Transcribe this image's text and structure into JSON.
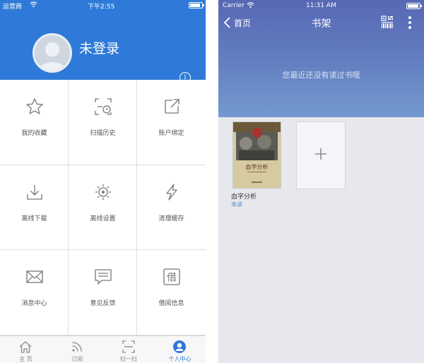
{
  "left": {
    "statusbar": {
      "carrier": "运营商",
      "time": "下午2:55",
      "battery_level": 0.9
    },
    "profile": {
      "username": "未登录",
      "info_icon": "info-icon"
    },
    "grid": [
      {
        "label": "我的收藏",
        "icon": "star-icon"
      },
      {
        "label": "扫描历史",
        "icon": "scan-history-icon"
      },
      {
        "label": "账户绑定",
        "icon": "share-link-icon"
      },
      {
        "label": "离线下载",
        "icon": "download-icon"
      },
      {
        "label": "离线设置",
        "icon": "settings-sun-icon"
      },
      {
        "label": "清理缓存",
        "icon": "lightning-icon"
      },
      {
        "label": "消息中心",
        "icon": "mail-icon"
      },
      {
        "label": "意见反馈",
        "icon": "chat-icon"
      },
      {
        "label": "借阅信息",
        "icon": "borrow-icon",
        "glyph": "借"
      }
    ],
    "tabbar": [
      {
        "label": "主 页",
        "icon": "home-icon",
        "active": false
      },
      {
        "label": "订阅",
        "icon": "rss-icon",
        "active": false
      },
      {
        "label": "扫一扫",
        "icon": "scan-icon",
        "active": false
      },
      {
        "label": "个人中心",
        "icon": "user-icon",
        "active": true
      }
    ],
    "colors": {
      "accent": "#2f7ad8",
      "grid_line": "#dedede"
    }
  },
  "right": {
    "statusbar": {
      "carrier": "Carrier",
      "time": "11:31 AM",
      "battery_level": 0.95
    },
    "nav": {
      "back_label": "首页",
      "title": "书架",
      "barcode_icon": "barcode-icon",
      "more_icon": "more-vertical-icon"
    },
    "empty_message": "您最近还没有读过书哦",
    "book": {
      "title": "血字分析",
      "status": "未读",
      "cover_text": "血字分析"
    },
    "add_tile": {
      "icon": "plus-icon"
    },
    "colors": {
      "hero_top": "#5768b4",
      "hero_bottom": "#7399d0",
      "link": "#4a8fd8"
    }
  }
}
